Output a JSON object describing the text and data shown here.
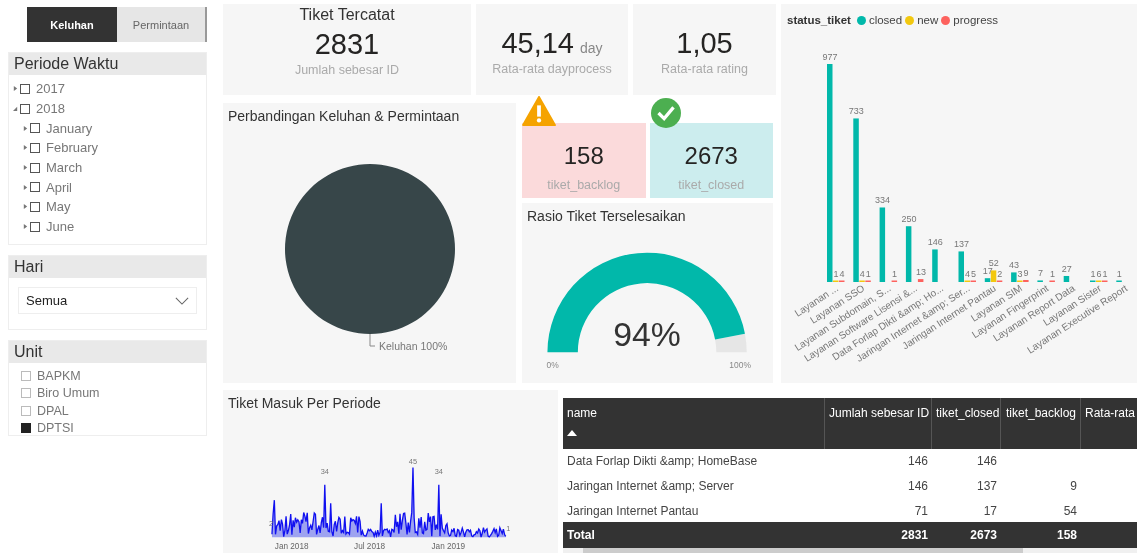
{
  "tabs": [
    {
      "label": "Keluhan",
      "selected": true
    },
    {
      "label": "Permintaan",
      "selected": false
    }
  ],
  "period_filter": {
    "title": "Periode Waktu",
    "items": [
      {
        "label": "2017",
        "expanded": false,
        "checked": false
      },
      {
        "label": "2018",
        "expanded": true,
        "checked": false,
        "children": [
          {
            "label": "January",
            "expanded": false,
            "checked": false
          },
          {
            "label": "February",
            "expanded": false,
            "checked": false
          },
          {
            "label": "March",
            "expanded": false,
            "checked": false
          },
          {
            "label": "April",
            "expanded": false,
            "checked": false
          },
          {
            "label": "May",
            "expanded": false,
            "checked": false
          },
          {
            "label": "June",
            "expanded": false,
            "checked": false
          }
        ]
      }
    ]
  },
  "day_filter": {
    "title": "Hari",
    "value": "Semua"
  },
  "unit_filter": {
    "title": "Unit",
    "items": [
      {
        "label": "BAPKM",
        "checked": false
      },
      {
        "label": "Biro Umum",
        "checked": false
      },
      {
        "label": "DPAL",
        "checked": false
      },
      {
        "label": "DPTSI",
        "checked": true
      }
    ]
  },
  "ticket_card": {
    "title": "Tiket Tercatat",
    "value": "2831",
    "label": "Jumlah sebesar ID"
  },
  "dayprocess_card": {
    "value": "45,14",
    "unit": "day",
    "label": "Rata-rata dayprocess"
  },
  "rating_card": {
    "value": "1,05",
    "label": "Rata-rata rating"
  },
  "comparison": {
    "title": "Perbandingan Keluhan & Permintaan",
    "chart_data": {
      "type": "pie",
      "categories": [
        "Keluhan"
      ],
      "value_labels": [
        "100%"
      ]
    }
  },
  "status_cards": [
    {
      "kind": "warning",
      "value": "158",
      "label": "tiket_backlog"
    },
    {
      "kind": "ok",
      "value": "2673",
      "label": "tiket_closed"
    }
  ],
  "ratio_gauge": {
    "title": "Rasio Tiket Terselesaikan",
    "value": "94%",
    "min_label": "0%",
    "max_label": "100%"
  },
  "status_chart": {
    "legend_title": "status_tiket",
    "chart_data": {
      "type": "bar",
      "categories": [
        "Layanan ...",
        "Layanan SSO",
        "Layanan Subdomain, S...",
        "Layanan Software Lisensi &...",
        "Data Forlap Dikti &amp; Ho...",
        "Jaringan Internet &amp; Ser...",
        "Jaringan Internet Pantau",
        "Layanan SIM",
        "Layanan Fingerprint",
        "Layanan Report Data",
        "Layanan Sister",
        "Layanan Executive Report"
      ],
      "data_labels": true,
      "series": [
        {
          "name": "closed",
          "color": "#01b8aa",
          "values": [
            977,
            733,
            334,
            250,
            146,
            137,
            17,
            43,
            7,
            27,
            1,
            1
          ]
        },
        {
          "name": "new",
          "color": "#f2c80f",
          "values": [
            1,
            4,
            null,
            null,
            null,
            4,
            52,
            3,
            null,
            null,
            6,
            null
          ]
        },
        {
          "name": "progress",
          "color": "#fd625e",
          "values": [
            4,
            1,
            1,
            13,
            null,
            5,
            2,
            9,
            1,
            null,
            1,
            null
          ]
        }
      ]
    }
  },
  "incoming": {
    "title": "Tiket Masuk Per Periode",
    "x_labels": [
      "Jan 2018",
      "Jul 2018",
      "Jan 2019"
    ],
    "point_labels": [
      "2",
      "34",
      "45",
      "34",
      "1"
    ]
  },
  "table": {
    "columns": [
      {
        "label": "name",
        "sorted": true
      },
      {
        "label": "Jumlah sebesar ID",
        "sorted": false
      },
      {
        "label": "tiket_closed",
        "sorted": false
      },
      {
        "label": "tiket_backlog",
        "sorted": false
      },
      {
        "label": "Rata-rata",
        "sorted": false
      }
    ],
    "rows": [
      [
        "Data Forlap Dikti &amp; HomeBase",
        "146",
        "146",
        null,
        null
      ],
      [
        "Jaringan Internet &amp; Server",
        "146",
        "137",
        "9",
        null
      ],
      [
        "Jaringan Internet Pantau",
        "71",
        "17",
        "54",
        null
      ]
    ],
    "total": [
      "Total",
      "2831",
      "2673",
      "158"
    ]
  }
}
